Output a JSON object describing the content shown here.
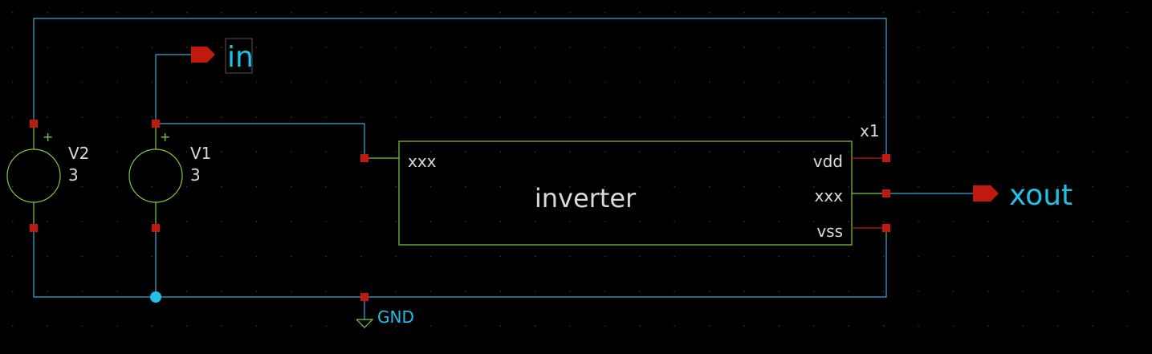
{
  "colors": {
    "background": "#000000",
    "grid_dot": "#3a3a3a",
    "wire": "#3aa7d8",
    "symbol": "#7ec843",
    "pin": "#c01a10",
    "label": "#d9d9d9",
    "netlabel": "#1fc1e6"
  },
  "sources": [
    {
      "name": "V2",
      "value": "3",
      "polarity": "+"
    },
    {
      "name": "V1",
      "value": "3",
      "polarity": "+"
    }
  ],
  "subcircuit": {
    "instance": "x1",
    "symbol_name": "inverter",
    "pins": {
      "in": "xxx",
      "vdd": "vdd",
      "out": "xxx",
      "vss": "vss"
    }
  },
  "nets": {
    "input_label": "in",
    "output_label": "xout",
    "ground_label": "GND"
  }
}
